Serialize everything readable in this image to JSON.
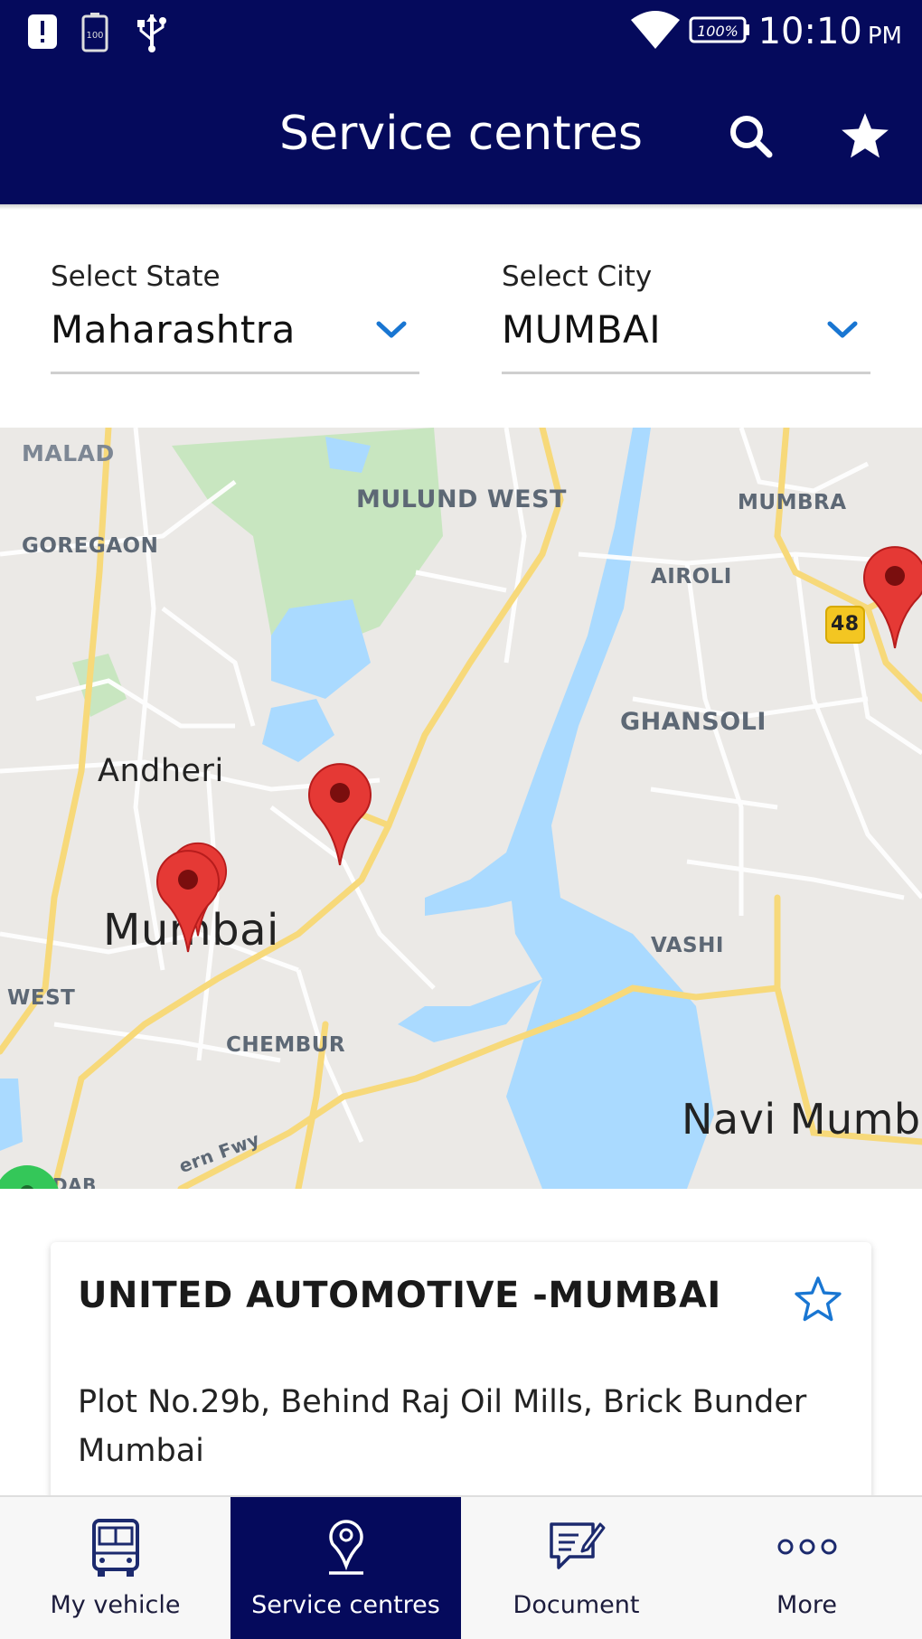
{
  "status_bar": {
    "time": "10:10",
    "ampm": "PM",
    "battery": "100%",
    "icons": [
      "alert-icon",
      "battery-saver-icon",
      "usb-icon",
      "wifi-icon",
      "battery-icon"
    ]
  },
  "app_bar": {
    "title": "Service centres",
    "actions": [
      "search-icon",
      "star-icon"
    ]
  },
  "filters": {
    "state": {
      "label": "Select State",
      "value": "Maharashtra"
    },
    "city": {
      "label": "Select City",
      "value": "MUMBAI"
    }
  },
  "map": {
    "labels": {
      "malad": "MALAD",
      "mulund_west": "MULUND WEST",
      "mumbra": "MUMBRA",
      "goregaon": "GOREGAON",
      "airoli": "AIROLI",
      "highway": "48",
      "ghansoli": "GHANSOLI",
      "andheri": "Andheri",
      "mumbai": "Mumbai",
      "vashi": "VASHI",
      "west": "WEST",
      "chembur": "CHEMBUR",
      "navi_mumbai": "Navi Mumba",
      "road_fwy": "ern Fwy",
      "road_dab": "DAB"
    },
    "colors": {
      "land": "#ebe9e6",
      "water": "#aadaff",
      "park": "#c8e6c0",
      "highway": "#f7d97a",
      "pin": "#e53935"
    }
  },
  "service_centre": {
    "name": "UNITED AUTOMOTIVE -MUMBAI",
    "address": "Plot No.29b, Behind Raj Oil Mills, Brick Bunder Mumbai"
  },
  "bottom_nav": {
    "items": [
      {
        "label": "My vehicle",
        "icon": "bus-icon",
        "active": false
      },
      {
        "label": "Service centres",
        "icon": "location-pin-icon",
        "active": true
      },
      {
        "label": "Document",
        "icon": "document-chat-icon",
        "active": false
      },
      {
        "label": "More",
        "icon": "more-dots-icon",
        "active": false
      }
    ]
  },
  "theme": {
    "primary": "#050a5c",
    "accent": "#1976d2"
  }
}
